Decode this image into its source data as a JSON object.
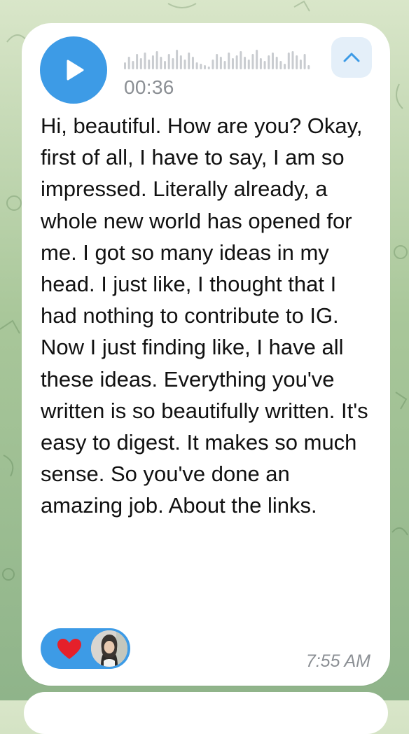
{
  "voice_message": {
    "duration": "00:36",
    "transcript": "Hi, beautiful. How are you? Okay, first of all, I have to say, I am so impressed. Literally already, a whole new world has opened for me. I got so many ideas in my head. I just like, I thought that I had nothing to contribute to IG. Now I just finding like, I have all these ideas. Everything you've written is so beautifully written. It's easy to digest. It makes so much sense. So you've done an amazing job. About the links.",
    "timestamp": "7:55 AM"
  },
  "reaction": {
    "emoji": "heart-icon",
    "color": "#e5202a"
  },
  "colors": {
    "accent": "#3d9be6",
    "bubble": "#ffffff",
    "muted_text": "#8b8f94"
  }
}
